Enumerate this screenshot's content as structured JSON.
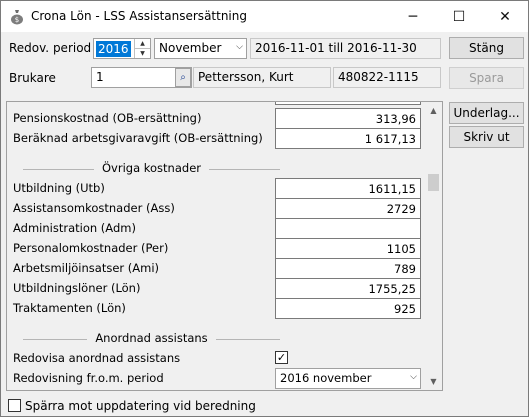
{
  "window": {
    "title": "Crona Lön - LSS Assistansersättning",
    "minimize": "─",
    "maximize": "☐",
    "close": "✕"
  },
  "header": {
    "period_label": "Redov. period",
    "year_value": "2016",
    "month_value": "November",
    "date_range": "2016-11-01 till 2016-11-30",
    "close_button": "Stäng",
    "user_label": "Brukare",
    "user_id": "1",
    "user_name": "Pettersson, Kurt",
    "user_pnr": "480822-1115",
    "save_button": "Spara"
  },
  "side_buttons": {
    "underlag": "Underlag...",
    "print": "Skriv ut"
  },
  "rows_top": [
    {
      "label": "Pensionskostnad (OB-ersättning)",
      "value": "313,96"
    },
    {
      "label": "Beräknad arbetsgivaravgift (OB-ersättning)",
      "value": "1 617,13"
    }
  ],
  "section_other": "Övriga kostnader",
  "rows_other": [
    {
      "label": "Utbildning (Utb)",
      "value": "1611,15"
    },
    {
      "label": "Assistansomkostnader (Ass)",
      "value": "2729"
    },
    {
      "label": "Administration (Adm)",
      "value": ""
    },
    {
      "label": "Personalomkostnader (Per)",
      "value": "1105"
    },
    {
      "label": "Arbetsmiljöinsatser (Ami)",
      "value": "789"
    },
    {
      "label": "Utbildningslöner (Lön)",
      "value": "1755,25"
    },
    {
      "label": "Traktamenten (Lön)",
      "value": "925"
    }
  ],
  "section_arranged": "Anordnad assistans",
  "arranged": {
    "report_label": "Redovisa anordnad assistans",
    "report_checked": "✓",
    "from_label": "Redovisning fr.o.m. period",
    "from_value": "2016 november"
  },
  "footer": {
    "lock_label": "Spärra mot uppdatering vid beredning"
  }
}
